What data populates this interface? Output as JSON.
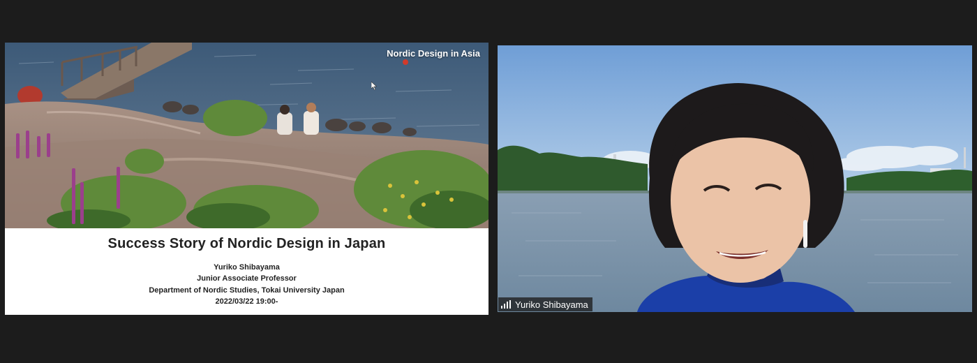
{
  "shared_slide": {
    "caption": "Nordic Design in Asia",
    "title": "Success Story of Nordic Design in Japan",
    "lines": [
      "Yuriko Shibayama",
      "Junior Associate Professor",
      "Department of Nordic Studies, Tokai University Japan",
      "2022/03/22 19:00-"
    ]
  },
  "participant": {
    "name": "Yuriko Shibayama",
    "signal_icon": "signal-bars-icon"
  },
  "colors": {
    "background": "#1c1c1c",
    "name_tag": "#1e1e1e",
    "slide_background": "#ffffff"
  }
}
